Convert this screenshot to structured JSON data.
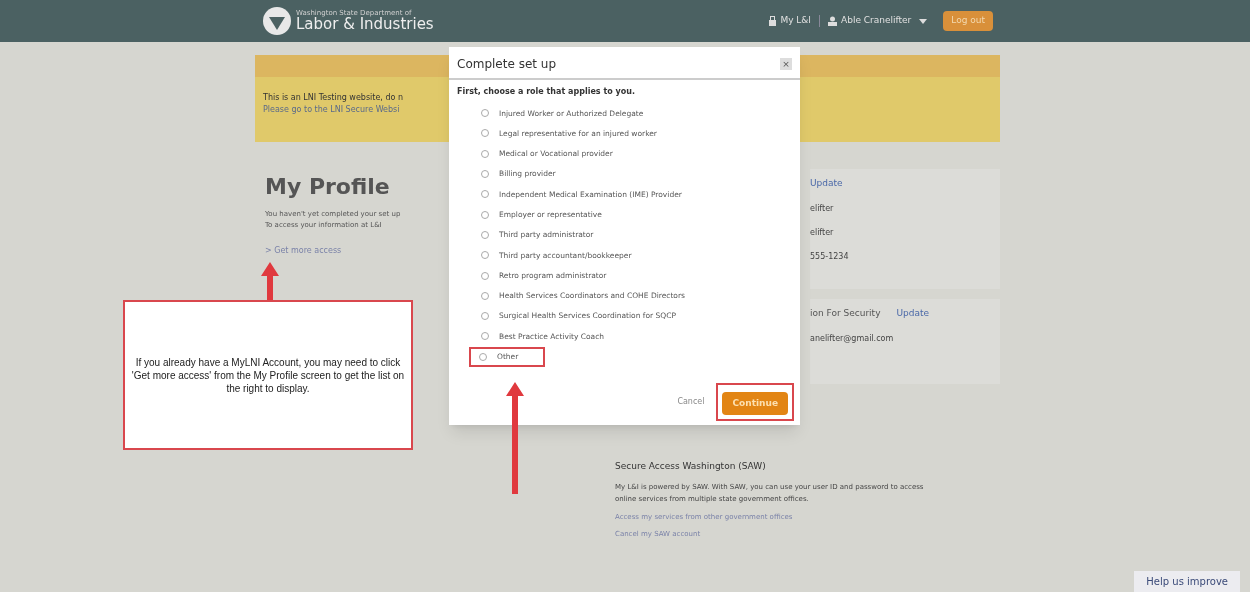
{
  "header": {
    "agency_small": "Washington State Department of",
    "agency": "Labor & Industries",
    "my_lni": "My L&I",
    "user": "Able Cranelifter",
    "logout": "Log out"
  },
  "banner": {
    "lines": [
      "This is an LNI Testing website, do n",
      "Please go to the LNI Secure Websi"
    ]
  },
  "profile": {
    "title": "My Profile",
    "lines": [
      "You haven't yet completed your set up",
      "To access your information at L&I"
    ],
    "link_marker": ">",
    "link": "Get more access"
  },
  "cards": [
    {
      "heading": "Update",
      "lines": [
        "elifter",
        "elifter",
        "555-1234"
      ]
    },
    {
      "heading": "ion For Security",
      "action": "Update",
      "lines": [
        "anelifter@gmail.com"
      ]
    }
  ],
  "saw": {
    "title": "Secure Access Washington (SAW)",
    "text": "My L&I is powered by SAW. With SAW, you can use your user ID and password to access online services from multiple state government offices.",
    "links": [
      "Access my services from other government offices",
      "Cancel my SAW account"
    ]
  },
  "help": "Help us improve",
  "callout": {
    "text": "If you already have a MyLNI Account, you may need to click 'Get more access' from the My Profile screen to get the list on the right to display."
  },
  "modal": {
    "title": "Complete set up",
    "close": "×",
    "prompt": "First, choose a role that applies to you.",
    "roles": [
      {
        "label": "Injured Worker or Authorized Delegate",
        "selected": false,
        "highlighted": false
      },
      {
        "label": "Legal representative for an injured worker",
        "selected": false,
        "highlighted": false
      },
      {
        "label": "Medical or Vocational provider",
        "selected": false,
        "highlighted": false
      },
      {
        "label": "Billing provider",
        "selected": false,
        "highlighted": false
      },
      {
        "label": "Independent Medical Examination (IME) Provider",
        "selected": false,
        "highlighted": false
      },
      {
        "label": "Employer or representative",
        "selected": false,
        "highlighted": false
      },
      {
        "label": "Third party administrator",
        "selected": false,
        "highlighted": false
      },
      {
        "label": "Third party accountant/bookkeeper",
        "selected": false,
        "highlighted": false
      },
      {
        "label": "Retro program administrator",
        "selected": false,
        "highlighted": false
      },
      {
        "label": "Health Services Coordinators and COHE Directors",
        "selected": false,
        "highlighted": false
      },
      {
        "label": "Surgical Health Services Coordination for SQCP",
        "selected": false,
        "highlighted": false
      },
      {
        "label": "Best Practice Activity Coach",
        "selected": false,
        "highlighted": false
      },
      {
        "label": "Other",
        "selected": false,
        "highlighted": true
      }
    ],
    "cancel": "Cancel",
    "continue": "Continue",
    "continue_highlighted": true
  }
}
